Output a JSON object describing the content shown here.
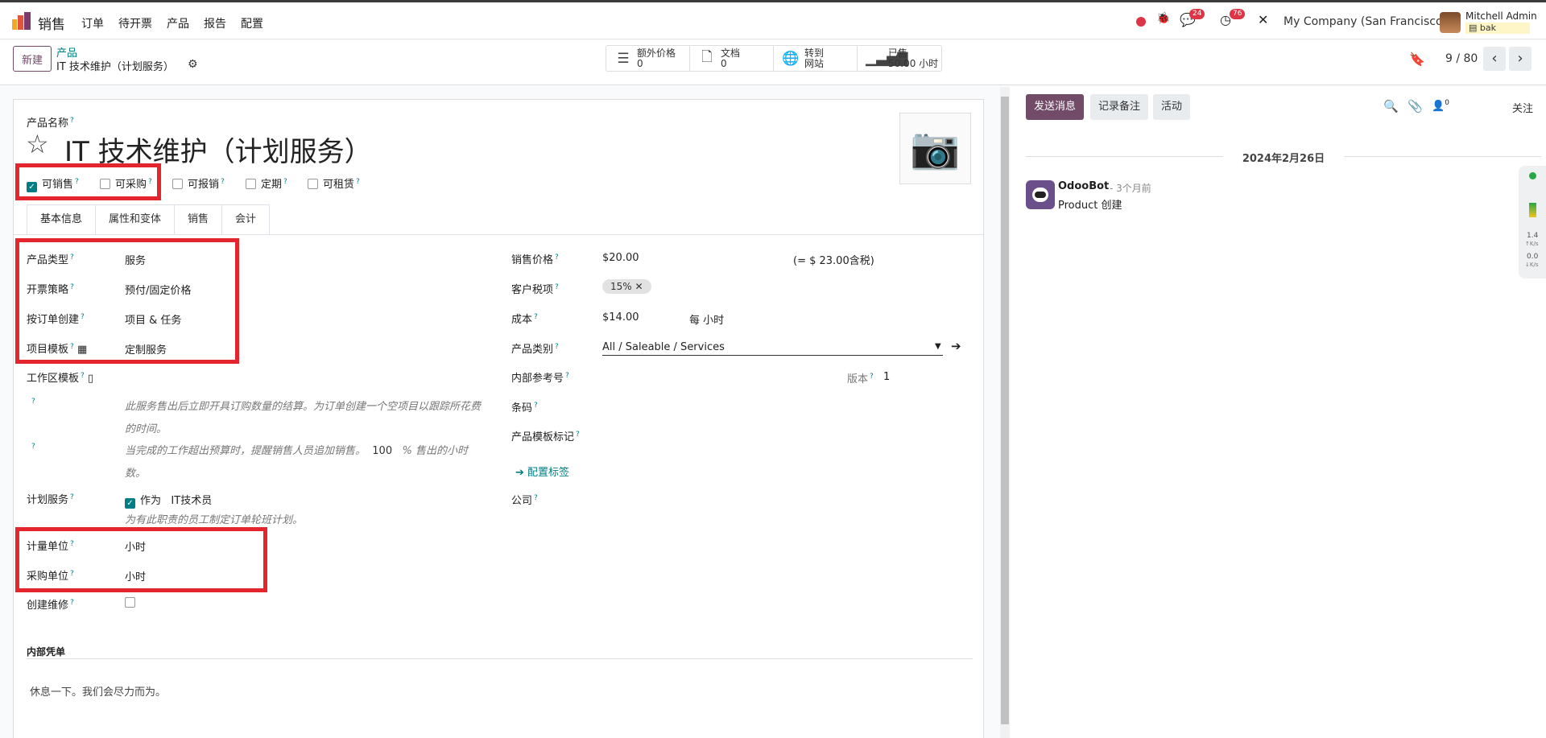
{
  "topbar": {
    "app_name": "销售",
    "menu": [
      "订单",
      "待开票",
      "产品",
      "报告",
      "配置"
    ],
    "chat_count": "24",
    "activity_count": "76",
    "company": "My Company (San Francisco)",
    "user_name": "Mitchell Admin",
    "db_name": "bak"
  },
  "control": {
    "new_label": "新建",
    "breadcrumb_parent": "产品",
    "breadcrumb_current": "IT 技术维护（计划服务）",
    "stats": [
      {
        "label": "额外价格",
        "value": "0",
        "icon": "list-icon"
      },
      {
        "label": "文档",
        "value": "0",
        "icon": "file-icon"
      },
      {
        "label": "转到",
        "value": "网站",
        "icon": "globe-icon"
      },
      {
        "label": "已售",
        "value": "50.00 小时",
        "icon": "bar-chart-icon"
      }
    ],
    "pager": "9 / 80"
  },
  "form": {
    "name_label": "产品名称",
    "product_name": "IT 技术维护（计划服务）",
    "flags": [
      {
        "label": "可销售",
        "checked": true
      },
      {
        "label": "可采购",
        "checked": false
      },
      {
        "label": "可报销",
        "checked": false
      },
      {
        "label": "定期",
        "checked": false
      },
      {
        "label": "可租赁",
        "checked": false
      }
    ],
    "tabs": [
      "基本信息",
      "属性和变体",
      "销售",
      "会计"
    ],
    "left": {
      "product_type_label": "产品类型",
      "product_type": "服务",
      "invoice_policy_label": "开票策略",
      "invoice_policy": "预付/固定价格",
      "create_on_order_label": "按订单创建",
      "create_on_order": "项目 & 任务",
      "project_template_label": "项目模板",
      "project_template": "定制服务",
      "workspace_template_label": "工作区模板",
      "help1": "此服务售出后立即开具订购数量的结算。为订单创建一个空项目以跟踪所花费的时间。",
      "help2_a": "当完成的工作超出预算时，提醒销售人员追加销售。",
      "help2_pct": "100",
      "help2_b": "% 售出的小时数。",
      "plan_service_label": "计划服务",
      "plan_as": "作为",
      "plan_role": "IT技术员",
      "plan_help": "为有此职责的员工制定订单轮班计划。",
      "uom_label": "计量单位",
      "uom": "小时",
      "purchase_uom_label": "采购单位",
      "purchase_uom": "小时",
      "create_repair_label": "创建维修"
    },
    "right": {
      "sale_price_label": "销售价格",
      "sale_price": "$20.00",
      "tax_incl": "(= $ 23.00含税)",
      "customer_tax_label": "客户税项",
      "customer_tax": "15%",
      "cost_label": "成本",
      "cost": "$14.00",
      "cost_per": "每 小时",
      "category_label": "产品类别",
      "category": "All / Saleable / Services",
      "internal_ref_label": "内部参考号",
      "version_label": "版本",
      "version": "1",
      "barcode_label": "条码",
      "template_tag_label": "产品模板标记",
      "config_tags": "配置标签",
      "company_label": "公司"
    },
    "internal_notes_label": "内部凭单",
    "internal_notes_placeholder": "休息一下。我们会尽力而为。"
  },
  "chatter": {
    "send_message": "发送消息",
    "log_note": "记录备注",
    "activity": "活动",
    "follower_count": "0",
    "follow": "关注",
    "date": "2024年2月26日",
    "author": "OdooBot",
    "time": "- 3个月前",
    "message": "Product 创建"
  },
  "speed_widget": {
    "up": "1.4",
    "down": "0.0",
    "unit": "K/s"
  }
}
